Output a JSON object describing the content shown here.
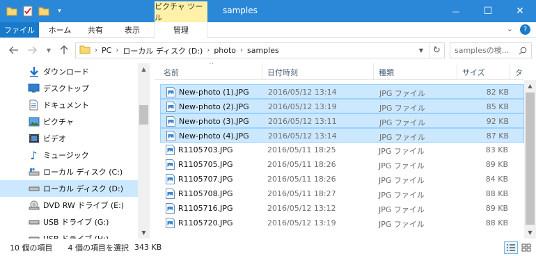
{
  "window": {
    "title": "samples",
    "context_tab": "ピクチャ ツール",
    "minimize": "—",
    "maximize": "☐",
    "close": "✕"
  },
  "ribbon": {
    "tabs": [
      "ファイル",
      "ホーム",
      "共有",
      "表示",
      "管理"
    ],
    "expand": "⌄",
    "help": "?"
  },
  "address": {
    "crumbs": [
      "PC",
      "ローカル ディスク (D:)",
      "photo",
      "samples"
    ],
    "search_placeholder": "samplesの検..."
  },
  "nav": {
    "items": [
      {
        "label": "ダウンロード",
        "icon": "download-icon"
      },
      {
        "label": "デスクトップ",
        "icon": "desktop-icon"
      },
      {
        "label": "ドキュメント",
        "icon": "document-icon"
      },
      {
        "label": "ピクチャ",
        "icon": "picture-icon"
      },
      {
        "label": "ビデオ",
        "icon": "video-icon"
      },
      {
        "label": "ミュージック",
        "icon": "music-icon"
      },
      {
        "label": "ローカル ディスク (C:)",
        "icon": "drive-icon"
      },
      {
        "label": "ローカル ディスク (D:)",
        "icon": "drive-icon",
        "selected": true
      },
      {
        "label": "DVD RW ドライブ (E:)",
        "icon": "dvd-icon"
      },
      {
        "label": "USB ドライブ (G:)",
        "icon": "usb-drive-icon"
      },
      {
        "label": "USB ドライブ (H:)",
        "icon": "usb-drive-icon"
      }
    ]
  },
  "columns": {
    "name": "名前",
    "date": "日付時刻",
    "type": "種類",
    "size": "サイズ",
    "extra": "タ"
  },
  "files": [
    {
      "name": "New-photo (1).JPG",
      "date": "2016/05/12 13:14",
      "type": "JPG ファイル",
      "size": "82 KB",
      "selected": true
    },
    {
      "name": "New-photo (2).JPG",
      "date": "2016/05/12 13:19",
      "type": "JPG ファイル",
      "size": "85 KB",
      "selected": true
    },
    {
      "name": "New-photo (3).JPG",
      "date": "2016/05/12 13:11",
      "type": "JPG ファイル",
      "size": "92 KB",
      "selected": true
    },
    {
      "name": "New-photo (4).JPG",
      "date": "2016/05/12 13:14",
      "type": "JPG ファイル",
      "size": "87 KB",
      "selected": true
    },
    {
      "name": "R1105703.JPG",
      "date": "2016/05/11 18:25",
      "type": "JPG ファイル",
      "size": "83 KB",
      "selected": false
    },
    {
      "name": "R1105705.JPG",
      "date": "2016/05/11 18:26",
      "type": "JPG ファイル",
      "size": "89 KB",
      "selected": false
    },
    {
      "name": "R1105707.JPG",
      "date": "2016/05/11 18:26",
      "type": "JPG ファイル",
      "size": "84 KB",
      "selected": false
    },
    {
      "name": "R1105708.JPG",
      "date": "2016/05/11 18:27",
      "type": "JPG ファイル",
      "size": "88 KB",
      "selected": false
    },
    {
      "name": "R1105716.JPG",
      "date": "2016/05/12 13:12",
      "type": "JPG ファイル",
      "size": "89 KB",
      "selected": false
    },
    {
      "name": "R1105720.JPG",
      "date": "2016/05/12 13:19",
      "type": "JPG ファイル",
      "size": "88 KB",
      "selected": false
    }
  ],
  "status": {
    "item_count": "10 個の項目",
    "selection": "4 個の項目を選択",
    "selection_size": "343 KB"
  },
  "colors": {
    "titlebar": "#2b88d8",
    "file_tab": "#1979ca",
    "context_tab": "#fff1a8",
    "selection": "#cce8ff"
  }
}
